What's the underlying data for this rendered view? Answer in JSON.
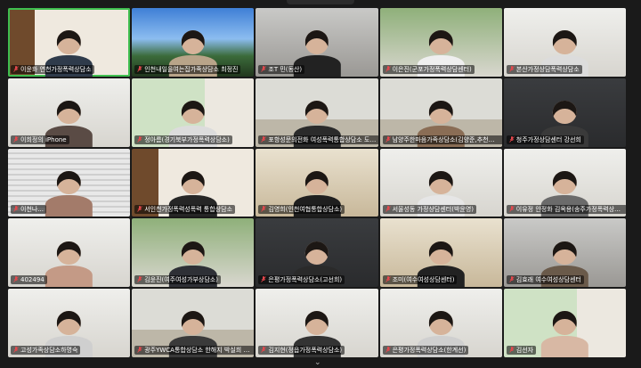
{
  "participants": [
    {
      "name": "이윤화 연천가정폭력상담소",
      "scene": "shelf",
      "shirt": "#2f3b4b",
      "active": true
    },
    {
      "name": "인천내일을여는집가족상담소 최정진",
      "scene": "sky",
      "shirt": "#b9a489",
      "active": false
    },
    {
      "name": "조T 민(동산)",
      "scene": "grey",
      "shirt": "#222222",
      "active": false
    },
    {
      "name": "이은진(군포가정폭력상담센터)",
      "scene": "green",
      "shirt": "#efefef",
      "active": false
    },
    {
      "name": "본산가정상담폭력상담소",
      "scene": "white",
      "shirt": "#dcdcdc",
      "active": false
    },
    {
      "name": "이희정의 iPhone",
      "scene": "white",
      "shirt": "#5a4b45",
      "active": false
    },
    {
      "name": "정아름(경기북부가정폭력상담소)",
      "scene": "window",
      "shirt": "#dcdcdc",
      "active": false
    },
    {
      "name": "포항성문의전화 여성폭력통합상담소 도은은",
      "scene": "office",
      "shirt": "#2b2b2b",
      "active": false
    },
    {
      "name": "남양주한마음가족상담소(김양준,추천미,김...",
      "scene": "office",
      "shirt": "#8a6d55",
      "active": false
    },
    {
      "name": "청주가정상담센터 강선희",
      "scene": "dark",
      "shirt": "#3a3a3a",
      "active": false
    },
    {
      "name": "이천나...",
      "scene": "blinds",
      "shirt": "#a37b6a",
      "active": false
    },
    {
      "name": "서인천가정폭력성폭력 통합상담소",
      "scene": "shelf",
      "shirt": "#262626",
      "active": false
    },
    {
      "name": "김영희(인천여협통합상담소)",
      "scene": "warm",
      "shirt": "#1f1f1f",
      "active": false
    },
    {
      "name": "서울성동 가정상담센터(박윤영)",
      "scene": "white",
      "shirt": "#e6e6e6",
      "active": false
    },
    {
      "name": "이유정 안정화 김옥용(송주가정폭력상담소)",
      "scene": "white",
      "shirt": "#6b6b6b",
      "active": false
    },
    {
      "name": "402494",
      "scene": "white",
      "shirt": "#c49a86",
      "active": false
    },
    {
      "name": "김윤진(여주여성가부상담소)",
      "scene": "green",
      "shirt": "#2e3036",
      "active": false
    },
    {
      "name": "은평가정폭력상담소(고선희)",
      "scene": "dark",
      "shirt": "#2a2a2a",
      "active": false
    },
    {
      "name": "조미(여수여성상담센터)",
      "scene": "warm",
      "shirt": "#222222",
      "active": false
    },
    {
      "name": "김효래 여수여성상담센터",
      "scene": "grey",
      "shirt": "#6a5a4a",
      "active": false
    },
    {
      "name": "고성가족상담소하명숙",
      "scene": "white",
      "shirt": "#cfcfcf",
      "active": false
    },
    {
      "name": "광주YWCA통합상담소 한해지 박실희 이주...",
      "scene": "office",
      "shirt": "#3a3a3a",
      "active": false
    },
    {
      "name": "김지현(정읍가정폭력상담소)",
      "scene": "white",
      "shirt": "#333333",
      "active": false
    },
    {
      "name": "은평가정폭력상담소(한계선)",
      "scene": "white",
      "shirt": "#cfcfcf",
      "active": false
    },
    {
      "name": "김선자",
      "scene": "window",
      "shirt": "#d8b8a4",
      "active": false
    }
  ],
  "colors": {
    "active_border": "#3fbf4f",
    "background": "#1a1a1a"
  },
  "icons": {
    "scroll_more": "chevron-down-icon",
    "muted": "mic-muted-icon"
  }
}
